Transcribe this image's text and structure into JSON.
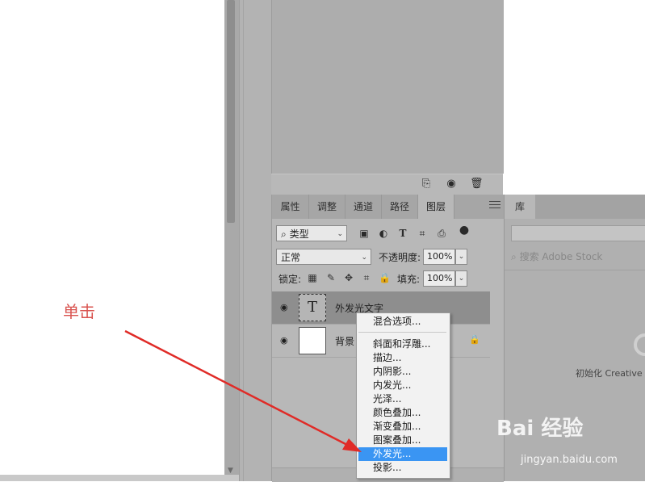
{
  "colors": {
    "menu_highlight": "#3a95f3",
    "annotation_red": "#d9534f"
  },
  "layers_panel": {
    "tabs": [
      {
        "label": "属性",
        "active": false
      },
      {
        "label": "调整",
        "active": false
      },
      {
        "label": "通道",
        "active": false
      },
      {
        "label": "路径",
        "active": false
      },
      {
        "label": "图层",
        "active": true
      }
    ],
    "filter_kind": "类型",
    "blend_mode": "正常",
    "opacity_label": "不透明度:",
    "opacity_value": "100%",
    "lock_label": "锁定:",
    "fill_label": "填充:",
    "fill_value": "100%",
    "layers": [
      {
        "name": "外发光文字",
        "type": "text",
        "thumb_glyph": "T",
        "selected": true
      },
      {
        "name": "背景",
        "type": "background",
        "locked": true,
        "selected": false
      }
    ]
  },
  "library": {
    "tab_label": "库",
    "search_placeholder": "搜索 Adobe Stock",
    "init_text": "初始化 Creative"
  },
  "context_menu": {
    "items": [
      {
        "label": "混合选项...",
        "highlighted": false
      },
      {
        "label": "斜面和浮雕...",
        "highlighted": false
      },
      {
        "label": "描边...",
        "highlighted": false
      },
      {
        "label": "内阴影...",
        "highlighted": false
      },
      {
        "label": "内发光...",
        "highlighted": false
      },
      {
        "label": "光泽...",
        "highlighted": false
      },
      {
        "label": "颜色叠加...",
        "highlighted": false
      },
      {
        "label": "渐变叠加...",
        "highlighted": false
      },
      {
        "label": "图案叠加...",
        "highlighted": false
      },
      {
        "label": "外发光...",
        "highlighted": true
      },
      {
        "label": "投影...",
        "highlighted": false
      }
    ]
  },
  "annotation": {
    "text": "单击"
  },
  "watermark": {
    "logo": "Bai 经验",
    "url": "jingyan.baidu.com"
  },
  "icons": {
    "eye": "eye-icon",
    "lock": "lock-icon",
    "search": "search-icon"
  }
}
